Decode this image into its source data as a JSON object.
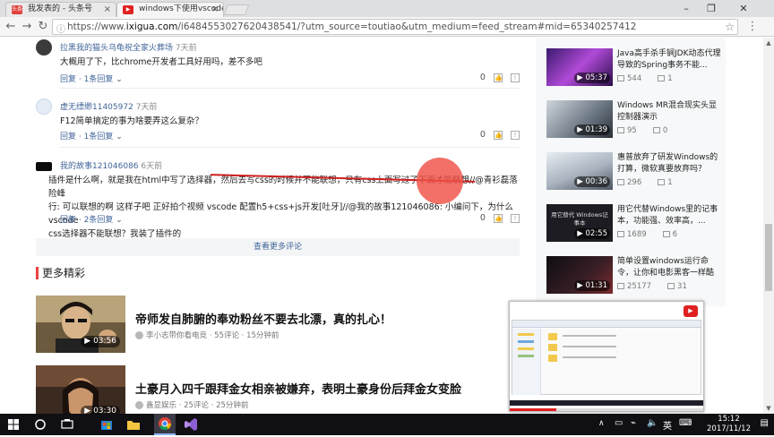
{
  "browser": {
    "tabs": [
      {
        "label": "我发表的 - 头条号",
        "favicon": "toutiao-icon"
      },
      {
        "label": "windows下使用vscode编...",
        "favicon": "xigua-icon"
      }
    ],
    "url_prefix": "https://www.",
    "url_domain": "ixigua.com",
    "url_rest": "/i6484553027620438541/?utm_source=toutiao&utm_medium=feed_stream#mid=65340257412"
  },
  "comments": [
    {
      "user": "拉黑我的猫头乌龟祝全家火葬场",
      "time": "7天前",
      "text_lines": [
        "大概用了下，比chrome开发者工具好用吗，差不多吧"
      ],
      "reply_label": "回复",
      "reply_count": "1条回复",
      "likes": "0"
    },
    {
      "user": "虚无缥缈11405972",
      "time": "7天前",
      "text_lines": [
        "F12简单搞定的事为啥要弄这么复杂？"
      ],
      "reply_label": "回复",
      "reply_count": "1条回复",
      "likes": "0"
    },
    {
      "user": "我的故事121046086",
      "time": "6天前",
      "text_lines": [
        "插件是什么啊，就是我在html中写了选择器，然后去写css的时候并不能联想，只有css上面写过了下面才能联想//@青衫磊落险峰",
        "行: 可以联想的啊 这样子吧 正好拍个视频 vscode 配置h5+css+js开发[吐牙]//@我的故事121046086: 小编问下，为什么vscode",
        "css选择器不能联想？我装了插件的"
      ],
      "reply_label": "回复",
      "reply_count": "2条回复",
      "likes": "0"
    }
  ],
  "more_comments_label": "查看更多评论",
  "more_section_title": "更多精彩",
  "feed": [
    {
      "title": "帝师发自肺腑的奉劝粉丝不要去北漂，真的扎心！",
      "author": "李小志带你看电竞",
      "comments": "55评论",
      "time": "15分钟前",
      "duration": "03:56"
    },
    {
      "title": "土豪月入四千跟拜金女相亲被嫌弃，表明土豪身份后拜金女变脸",
      "author": "鑫显娱乐",
      "comments": "25评论",
      "time": "25分钟前",
      "duration": "03:30"
    }
  ],
  "related": [
    {
      "title": "Java高手杀手锏JDK动态代理导致的Spring事务不能...",
      "duration": "05:37",
      "views": "544",
      "comments": "1"
    },
    {
      "title": "Windows MR混合现实头显控制器演示",
      "duration": "01:39",
      "views": "95",
      "comments": "0"
    },
    {
      "title": "惠普放弃了研发Windows的打算，微软真要放弃吗？",
      "duration": "00:36",
      "views": "296",
      "comments": "1"
    },
    {
      "title": "用它代替Windows里的记事本，功能强、效率高，...",
      "duration": "02:55",
      "views": "1689",
      "comments": "6",
      "thumb_text": "用它替代 Windows记事本"
    },
    {
      "title": "简单设置windows运行命令，让你和电影黑客一样酷",
      "duration": "01:31",
      "views": "25177",
      "comments": "31"
    }
  ],
  "pip": {
    "progress": 0.24
  },
  "taskbar": {
    "ime": "英",
    "time": "15:12",
    "date": "2017/11/12"
  }
}
